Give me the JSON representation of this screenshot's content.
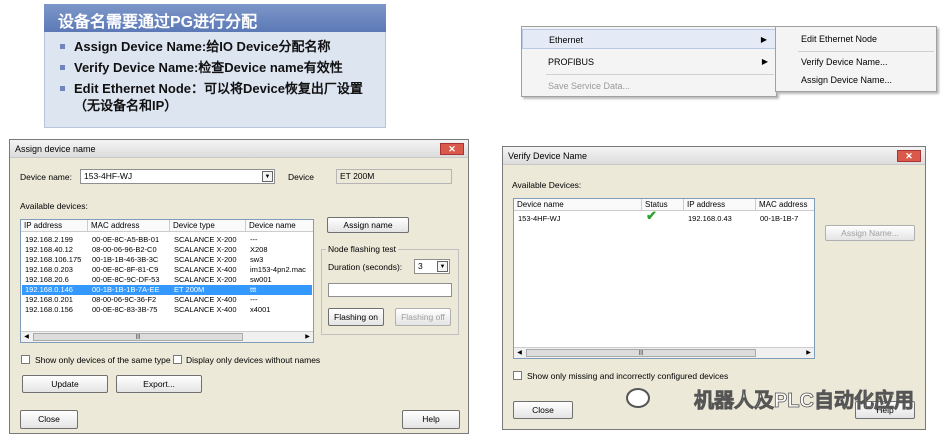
{
  "info": {
    "title": "设备名需要通过PG进行分配",
    "bullets": [
      "Assign Device Name:给IO Device分配名称",
      "Verify Device Name:检查Device name有效性",
      "Edit Ethernet Node：可以将Device恢复出厂设置（无设备名和IP）"
    ]
  },
  "context_menu": {
    "items": [
      {
        "label": "Ethernet",
        "has_submenu": true,
        "selected": true
      },
      {
        "label": "PROFIBUS",
        "has_submenu": true
      },
      {
        "label": "Save Service Data...",
        "disabled": true
      }
    ],
    "submenu": [
      "Edit Ethernet Node",
      "Verify Device Name...",
      "Assign Device Name..."
    ]
  },
  "assign": {
    "title": "Assign device name",
    "device_name_label": "Device name:",
    "device_name_value": "153-4HF-WJ",
    "device_label": "Device",
    "device_value": "ET 200M",
    "available_label": "Available devices:",
    "columns": [
      "IP address",
      "MAC address",
      "Device type",
      "Device name"
    ],
    "rows": [
      [
        "192.168.2.199",
        "00-0E-8C-A5-BB-01",
        "SCALANCE X-200",
        "---"
      ],
      [
        "192.168.40.12",
        "08-00-06-96-B2-C0",
        "SCALANCE X-200",
        "X208"
      ],
      [
        "192.168.106.175",
        "00-1B-1B-46-3B-3C",
        "SCALANCE X-200",
        "sw3"
      ],
      [
        "192.168.0.203",
        "00-0E-8C-8F-81-C9",
        "SCALANCE X-400",
        "im153-4pn2.mac"
      ],
      [
        "192.168.20.6",
        "00-0E-8C-9C-DF-53",
        "SCALANCE X-200",
        "sw001"
      ],
      [
        "192.168.0.146",
        "00-1B-1B-1B-7A-EE",
        "ET 200M",
        "ttt"
      ],
      [
        "192.168.0.201",
        "08-00-06-9C-36-F2",
        "SCALANCE X-400",
        "---"
      ],
      [
        "192.168.0.156",
        "00-0E-8C-83-3B-75",
        "SCALANCE X-400",
        "x4001"
      ]
    ],
    "selected_row": 5,
    "assign_button": "Assign name",
    "flash_group": "Node flashing test",
    "duration_label": "Duration (seconds):",
    "duration_value": "3",
    "flashing_on": "Flashing on",
    "flashing_off": "Flashing off",
    "check_same_type": "Show only devices of the same type",
    "check_without_names": "Display only devices without names",
    "update": "Update",
    "export": "Export...",
    "close": "Close",
    "help": "Help"
  },
  "verify": {
    "title": "Verify Device Name",
    "available_label": "Available Devices:",
    "columns": [
      "Device name",
      "Status",
      "IP address",
      "MAC address"
    ],
    "rows": [
      [
        "153-4HF-WJ",
        "✔",
        "192.168.0.43",
        "00-1B-1B-7"
      ]
    ],
    "assign_button": "Assign Name...",
    "check_missing": "Show only missing and incorrectly configured devices",
    "close": "Close",
    "help": "Help"
  },
  "watermark": "机器人及PLC自动化应用"
}
